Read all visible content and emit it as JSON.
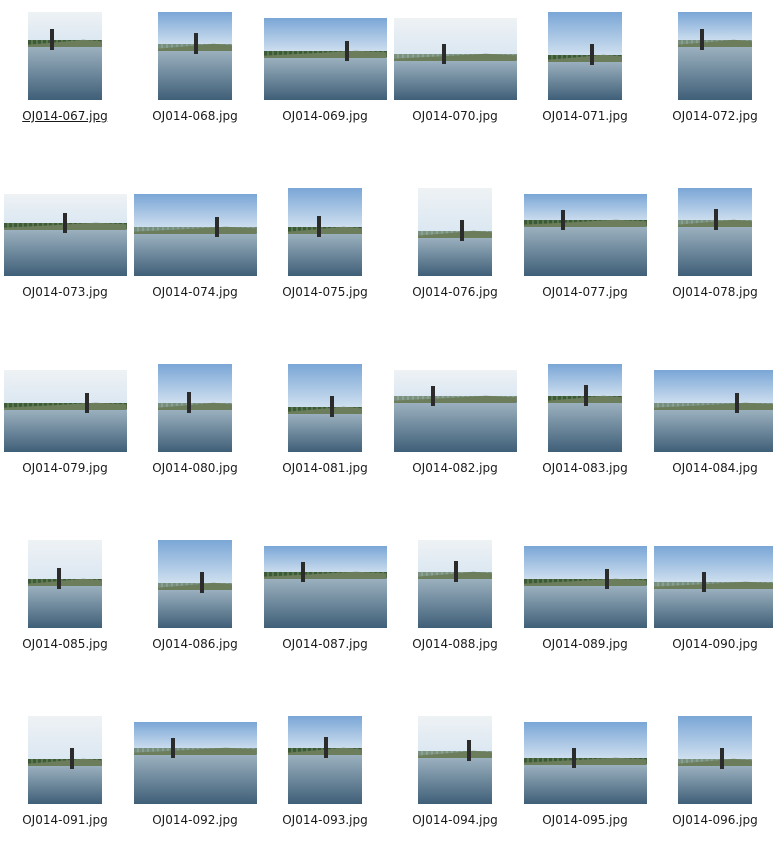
{
  "thumbnails": [
    {
      "file": "OJ014-067.jpg",
      "orientation": "portrait"
    },
    {
      "file": "OJ014-068.jpg",
      "orientation": "portrait"
    },
    {
      "file": "OJ014-069.jpg",
      "orientation": "landscape"
    },
    {
      "file": "OJ014-070.jpg",
      "orientation": "landscape"
    },
    {
      "file": "OJ014-071.jpg",
      "orientation": "portrait"
    },
    {
      "file": "OJ014-072.jpg",
      "orientation": "portrait"
    },
    {
      "file": "OJ014-073.jpg",
      "orientation": "landscape"
    },
    {
      "file": "OJ014-074.jpg",
      "orientation": "landscape"
    },
    {
      "file": "OJ014-075.jpg",
      "orientation": "portrait"
    },
    {
      "file": "OJ014-076.jpg",
      "orientation": "portrait"
    },
    {
      "file": "OJ014-077.jpg",
      "orientation": "landscape"
    },
    {
      "file": "OJ014-078.jpg",
      "orientation": "portrait"
    },
    {
      "file": "OJ014-079.jpg",
      "orientation": "landscape"
    },
    {
      "file": "OJ014-080.jpg",
      "orientation": "portrait"
    },
    {
      "file": "OJ014-081.jpg",
      "orientation": "portrait"
    },
    {
      "file": "OJ014-082.jpg",
      "orientation": "landscape"
    },
    {
      "file": "OJ014-083.jpg",
      "orientation": "portrait"
    },
    {
      "file": "OJ014-084.jpg",
      "orientation": "landscape"
    },
    {
      "file": "OJ014-085.jpg",
      "orientation": "portrait"
    },
    {
      "file": "OJ014-086.jpg",
      "orientation": "portrait"
    },
    {
      "file": "OJ014-087.jpg",
      "orientation": "landscape"
    },
    {
      "file": "OJ014-088.jpg",
      "orientation": "portrait"
    },
    {
      "file": "OJ014-089.jpg",
      "orientation": "landscape"
    },
    {
      "file": "OJ014-090.jpg",
      "orientation": "landscape"
    },
    {
      "file": "OJ014-091.jpg",
      "orientation": "portrait"
    },
    {
      "file": "OJ014-092.jpg",
      "orientation": "landscape"
    },
    {
      "file": "OJ014-093.jpg",
      "orientation": "portrait"
    },
    {
      "file": "OJ014-094.jpg",
      "orientation": "portrait"
    },
    {
      "file": "OJ014-095.jpg",
      "orientation": "landscape"
    },
    {
      "file": "OJ014-096.jpg",
      "orientation": "portrait"
    }
  ],
  "colors": {
    "sky_top": "#7aa6d6",
    "sky_bottom": "#d9e6f2",
    "pale_sky": "#eef2f4",
    "hill": "#6b7d5a",
    "water_top": "#9fb4c2",
    "water_bottom": "#3f5f78",
    "text": "#1a1a1a"
  }
}
